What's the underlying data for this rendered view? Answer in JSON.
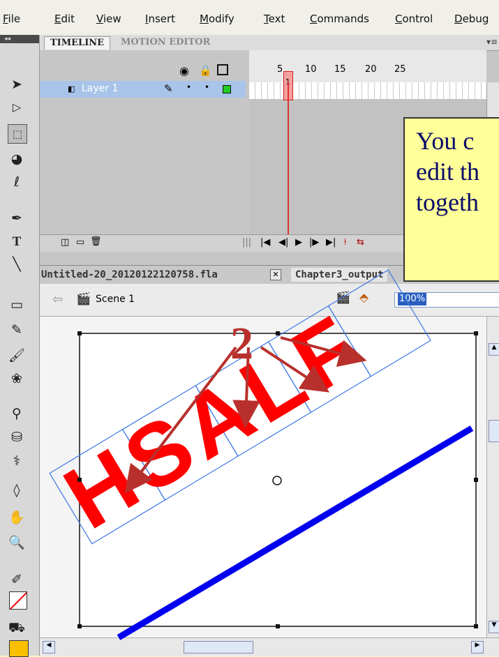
{
  "menubar": {
    "items": [
      "File",
      "Edit",
      "View",
      "Insert",
      "Modify",
      "Text",
      "Commands",
      "Control",
      "Debug"
    ]
  },
  "timeline": {
    "tabs": [
      "TIMELINE",
      "MOTION EDITOR"
    ],
    "frame_numbers": [
      "1",
      "5",
      "10",
      "15",
      "20",
      "25"
    ],
    "layer_name": "Layer 1"
  },
  "document_tabs": [
    "Untitled-20_20120122120758.fla",
    "Chapter3_output"
  ],
  "editbar": {
    "scene": "Scene 1",
    "zoom": "100%"
  },
  "stage": {
    "number_label": "2",
    "artwork_text": "HSALF",
    "colors": {
      "letters": "#ff0000",
      "path": "#0000ee",
      "arrows": "#b8302c",
      "selection": "#3c78e6"
    }
  },
  "callout": {
    "lines": [
      "You c",
      "edit th",
      "togeth"
    ]
  },
  "colors": {
    "background": "#fbf6c6",
    "callout": "#ffff99"
  }
}
